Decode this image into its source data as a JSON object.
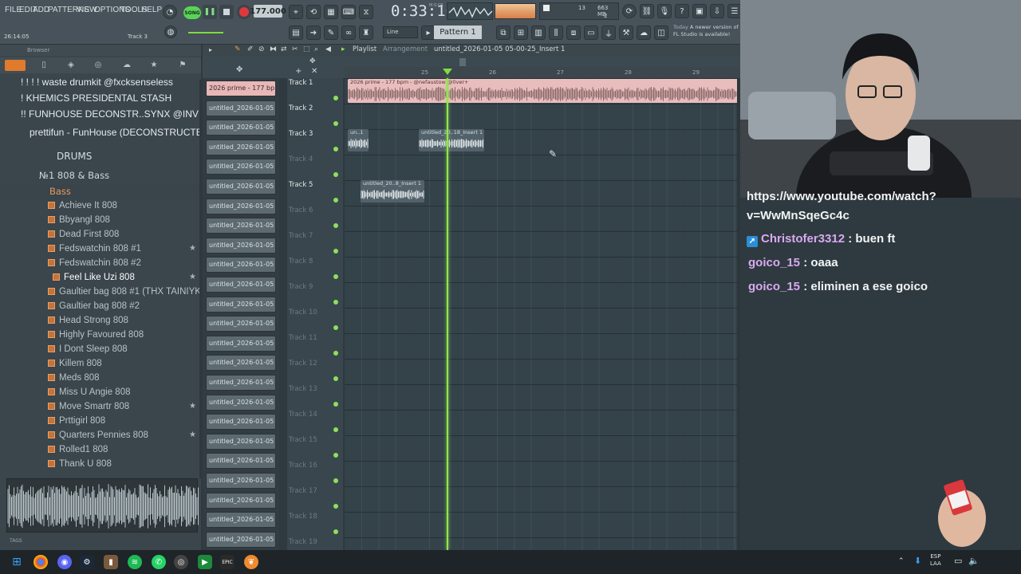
{
  "menu": [
    "FILE",
    "EDIT",
    "ADD",
    "PATTERNS",
    "VIEW",
    "OPTIONS",
    "TOOLS",
    "HELP"
  ],
  "transport": {
    "song_label": "SONG",
    "tempo": "177.000",
    "clock": "0:33:10",
    "clock_sub": "M:S:CS",
    "cpu_value": "13",
    "memory": "663 MB",
    "polyphony": "2"
  },
  "toolbar": {
    "snap_mode": "Line",
    "pattern": "Pattern 1",
    "update_hint_today": "Today",
    "update_hint_text": "A newer version of FL Studio is available!"
  },
  "status": {
    "time": "26:14:05",
    "track": "Track 3"
  },
  "browser": {
    "title": "Browser",
    "items": [
      {
        "label": "! ! ! ! waste drumkit @fxcksenseless",
        "kind": "top"
      },
      {
        "label": "! KHEMICS PRESIDENTAL STASH",
        "kind": "top"
      },
      {
        "label": "!! FUNHOUSE DECONSTR..SYNX @INVITE @DEILAS",
        "kind": "top"
      },
      {
        "label": "prettifun - FunHouse (DECONSTRUCTED)",
        "kind": "top"
      },
      {
        "label": "DRUMS",
        "kind": "drums"
      },
      {
        "label": "№1 808 & Bass",
        "kind": "sub"
      },
      {
        "label": "Bass",
        "kind": "bass"
      }
    ],
    "files": [
      {
        "label": "Achieve It 808",
        "star": false
      },
      {
        "label": "Bbyangl 808",
        "star": false
      },
      {
        "label": "Dead First 808",
        "star": false
      },
      {
        "label": "Fedswatchin 808 #1",
        "star": true
      },
      {
        "label": "Fedswatchin 808 #2",
        "star": false
      },
      {
        "label": "Feel Like Uzi 808",
        "star": true,
        "selected": true
      },
      {
        "label": "Gaultier bag 808 #1 (THX TAINIYKICK)",
        "star": false
      },
      {
        "label": "Gaultier bag 808 #2",
        "star": false
      },
      {
        "label": "Head Strong 808",
        "star": false
      },
      {
        "label": "Highly Favoured 808",
        "star": false
      },
      {
        "label": "I Dont Sleep 808",
        "star": false
      },
      {
        "label": "Killem 808",
        "star": false
      },
      {
        "label": "Meds 808",
        "star": false
      },
      {
        "label": "Miss U Angie 808",
        "star": false
      },
      {
        "label": "Move Smartr 808",
        "star": true
      },
      {
        "label": "Prttigirl 808",
        "star": false
      },
      {
        "label": "Quarters Pennies 808",
        "star": true
      },
      {
        "label": "Rolled1 808",
        "star": false
      },
      {
        "label": "Thank U 808",
        "star": false
      }
    ],
    "tags_label": "TAGS"
  },
  "playlist": {
    "title": "Playlist",
    "subtitle": "Arrangement",
    "pattern_name": "untitled_2026-01-05 05-00-25_Insert 1",
    "bar_numbers": [
      "25",
      "26",
      "27",
      "28",
      "29"
    ],
    "pattern_items": [
      "2026 prime - 177 bp..",
      "untitled_2026-01-05 04-",
      "untitled_2026-01-05 04-",
      "untitled_2026-01-05 04-",
      "untitled_2026-01-05 04-",
      "untitled_2026-01-05 04-",
      "untitled_2026-01-05 04-",
      "untitled_2026-01-05 04-",
      "untitled_2026-01-05 04-",
      "untitled_2026-01-05 04-",
      "untitled_2026-01-05 04-",
      "untitled_2026-01-05 04-",
      "untitled_2026-01-05 04-",
      "untitled_2026-01-05 04-",
      "untitled_2026-01-05 04-",
      "untitled_2026-01-05 04-",
      "untitled_2026-01-05 04-",
      "untitled_2026-01-05 04-",
      "untitled_2026-01-05 05-",
      "untitled_2026-01-05 05-",
      "untitled_2026-01-05 05-",
      "untitled_2026-01-05 05-",
      "untitled_2026-01-05 05-",
      "untitled_2026-01-05 05-"
    ],
    "tracks": [
      "Track 1",
      "Track 2",
      "Track 3",
      "Track 4",
      "Track 5",
      "Track 6",
      "Track 7",
      "Track 8",
      "Track 9",
      "Track 10",
      "Track 11",
      "Track 12",
      "Track 13",
      "Track 14",
      "Track 15",
      "Track 16",
      "Track 17",
      "Track 18",
      "Track 19"
    ],
    "clips": {
      "main": "2026 prime - 177 bpm - @nefaustow @0ver+",
      "track3_a": "un..1",
      "track3_b": "untitled_20..18_Insert 1",
      "track5": "untitled_20..8_Insert 1"
    }
  },
  "chat": {
    "url_line1": "https://www.youtube.com/watch?",
    "url_line2": "v=WwMnSqeGc4c",
    "messages": [
      {
        "user": "Christofer3312",
        "text": ": buen ft",
        "badge": true
      },
      {
        "user": "goico_15",
        "text": ": oaaa",
        "badge": false
      },
      {
        "user": "goico_15",
        "text": ": eliminen a ese goico",
        "badge": false
      }
    ]
  },
  "taskbar": {
    "lang": "ESP",
    "region": "LAA"
  },
  "colors": {
    "accent_orange": "#e07a2c",
    "playhead_green": "#8fe84a",
    "audio_clip_pink": "#e9bdbd",
    "chat_username": "#d9a9f0"
  }
}
